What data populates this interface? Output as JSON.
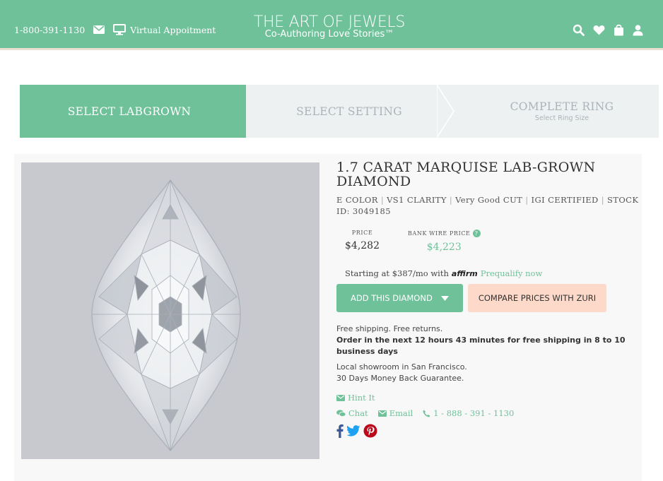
{
  "header": {
    "phone": "1-800-391-1130",
    "virtual": "Virtual Appoitment",
    "brand_title": "THE ART OF JEWELS",
    "brand_tagline": "Co-Authoring Love Stories™"
  },
  "steps": [
    {
      "label": "SELECT LABGROWN",
      "sub": ""
    },
    {
      "label": "SELECT SETTING",
      "sub": ""
    },
    {
      "label": "COMPLETE RING",
      "sub": "Select Ring Size"
    }
  ],
  "product": {
    "title": "1.7 CARAT MARQUISE LAB-GROWN DIAMOND",
    "spec_color": "E COLOR",
    "spec_clarity": "VS1 CLARITY",
    "spec_cut": "Very Good CUT",
    "spec_cert": "IGI CERTIFIED",
    "spec_stock": "STOCK ID: 3049185",
    "price_label": "PRICE",
    "price": "$4,282",
    "wire_label": "BANK WIRE PRICE",
    "wire_price": "$4,223",
    "affirm_text": "Starting at $387/mo with",
    "affirm_logo": "affirm",
    "prequalify": "Prequalify now",
    "add_btn": "ADD THIS DIAMOND",
    "compare_btn": "COMPARE PRICES WITH ZURI",
    "ship1": "Free shipping. Free returns.",
    "ship2": "Order in the next 12 hours 43 minutes for free shipping in 8 to 10 business days",
    "showroom1": "Local showroom in San Francisco.",
    "showroom2": "30 Days Money Back Guarantee.",
    "hint": "Hint It",
    "chat": "Chat",
    "email": "Email",
    "phone": "1 - 888 - 391 - 1130"
  },
  "colors": {
    "accent": "#6fc199",
    "compare": "#fcd9c9",
    "step_inactive": "#eef1f2"
  }
}
